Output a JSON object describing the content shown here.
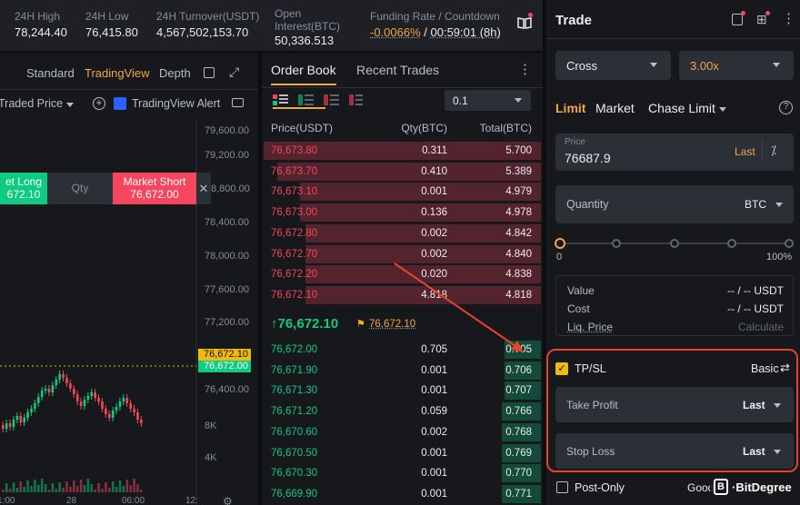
{
  "ticker": {
    "high_label": "24H High",
    "high": "78,244.40",
    "low_label": "24H Low",
    "low": "76,415.80",
    "turnover_label": "24H Turnover(USDT)",
    "turnover": "4,567,502,153.70",
    "oi_label_1": "Open",
    "oi_label_2": "Interest(BTC)",
    "oi": "50,336.513",
    "funding_label": "Funding Rate / Countdown",
    "funding_rate": "-0.0066%",
    "funding_sep": " / ",
    "countdown": "00:59:01 (8h)"
  },
  "chart": {
    "view_standard": "Standard",
    "view_tradingview": "TradingView",
    "view_depth": "Depth",
    "price_type": "Traded Price",
    "alert": "TradingView Alert",
    "long_label_1": "et Long",
    "long_label_2": "672.10",
    "qty_label": "Qty",
    "short_label_1": "Market Short",
    "short_label_2": "76,672.00",
    "axis": [
      "79,200.00",
      "8,800.00",
      "78,400.00",
      "78,000.00",
      "77,600.00",
      "77,200.00",
      "76,400.00"
    ],
    "axis_top": "79,600.00",
    "price_tag_1": "76,672.10",
    "price_tag_2": "76,672.00",
    "vol_axis": [
      "8K",
      "4K"
    ],
    "time_axis": [
      "1:00",
      "28",
      "06:00",
      "12:"
    ]
  },
  "orderbook": {
    "tab_orderbook": "Order Book",
    "tab_trades": "Recent Trades",
    "precision": "0.1",
    "col_price": "Price(USDT)",
    "col_qty": "Qty(BTC)",
    "col_total": "Total(BTC)",
    "asks": [
      {
        "p": "76,673.80",
        "q": "0.311",
        "t": "5.700",
        "d": 1.0
      },
      {
        "p": "76,673.70",
        "q": "0.410",
        "t": "5.389",
        "d": 0.95
      },
      {
        "p": "76,673.10",
        "q": "0.001",
        "t": "4.979",
        "d": 0.87
      },
      {
        "p": "76,673.00",
        "q": "0.136",
        "t": "4.978",
        "d": 0.87
      },
      {
        "p": "76,672.80",
        "q": "0.002",
        "t": "4.842",
        "d": 0.85
      },
      {
        "p": "76,672.70",
        "q": "0.002",
        "t": "4.840",
        "d": 0.85
      },
      {
        "p": "76,672.20",
        "q": "0.020",
        "t": "4.838",
        "d": 0.85
      },
      {
        "p": "76,672.10",
        "q": "4.818",
        "t": "4.818",
        "d": 0.85
      }
    ],
    "last_price": "↑76,672.10",
    "mark_price": "76,672.10",
    "bids": [
      {
        "p": "76,672.00",
        "q": "0.705",
        "t": "0.705",
        "d": 0.13
      },
      {
        "p": "76,671.90",
        "q": "0.001",
        "t": "0.706",
        "d": 0.13
      },
      {
        "p": "76,671.30",
        "q": "0.001",
        "t": "0.707",
        "d": 0.13
      },
      {
        "p": "76,671.20",
        "q": "0.059",
        "t": "0.766",
        "d": 0.14
      },
      {
        "p": "76,670.60",
        "q": "0.002",
        "t": "0.768",
        "d": 0.14
      },
      {
        "p": "76,670.50",
        "q": "0.001",
        "t": "0.769",
        "d": 0.14
      },
      {
        "p": "76,670.30",
        "q": "0.001",
        "t": "0.770",
        "d": 0.14
      },
      {
        "p": "76,669.90",
        "q": "0.001",
        "t": "0.771",
        "d": 0.14
      }
    ]
  },
  "trade": {
    "title": "Trade",
    "margin_mode": "Cross",
    "leverage": "3.00x",
    "tab_limit": "Limit",
    "tab_market": "Market",
    "tab_chase": "Chase Limit",
    "price_label": "Price",
    "price_value": "76687.9",
    "price_last": "Last",
    "qty_label": "Quantity",
    "qty_unit": "BTC",
    "slider_min": "0",
    "slider_max": "100%",
    "slider_level": 0,
    "value_label": "Value",
    "cost_label": "Cost",
    "liq_label": "Liq. Price",
    "value_val": "-- / -- USDT",
    "cost_val": "-- / -- USDT",
    "liq_val": "Calculate",
    "tpsl_label": "TP/SL",
    "tpsl_mode": "Basic",
    "tp_label": "Take Profit",
    "tp_trigger": "Last",
    "sl_label": "Stop Loss",
    "sl_trigger": "Last",
    "post_only": "Post-Only",
    "tif_partial": "Good",
    "watermark": "BitDegree"
  }
}
